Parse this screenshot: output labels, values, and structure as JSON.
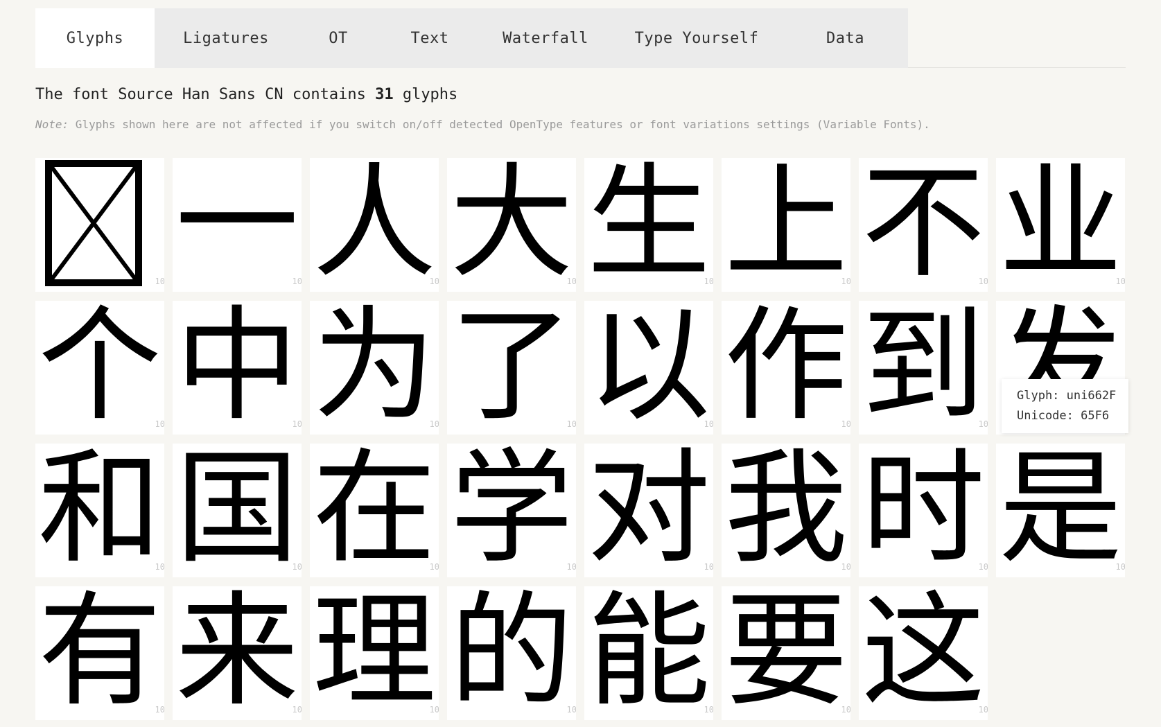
{
  "tabs": [
    {
      "label": "Glyphs",
      "active": true
    },
    {
      "label": "Ligatures",
      "active": false
    },
    {
      "label": "OT",
      "active": false
    },
    {
      "label": "Text",
      "active": false
    },
    {
      "label": "Waterfall",
      "active": false
    },
    {
      "label": "Type Yourself",
      "active": false
    },
    {
      "label": "Data",
      "active": false
    }
  ],
  "summary": {
    "prefix": "The font Source Han Sans CN contains ",
    "count": "31",
    "suffix": " glyphs"
  },
  "note": {
    "label": "Note:",
    "text": " Glyphs shown here are not affected if you switch on/off detected OpenType features or font variations settings (Variable Fonts)."
  },
  "glyphs": [
    {
      "char": "",
      "notdef": true,
      "num": "10"
    },
    {
      "char": "一",
      "num": "10"
    },
    {
      "char": "人",
      "num": "10"
    },
    {
      "char": "大",
      "num": "10"
    },
    {
      "char": "生",
      "num": "10"
    },
    {
      "char": "上",
      "num": "10"
    },
    {
      "char": "不",
      "num": "10"
    },
    {
      "char": "业",
      "num": "10"
    },
    {
      "char": "个",
      "num": "10"
    },
    {
      "char": "中",
      "num": "10"
    },
    {
      "char": "为",
      "num": "10"
    },
    {
      "char": "了",
      "num": "10"
    },
    {
      "char": "以",
      "num": "10"
    },
    {
      "char": "作",
      "num": "10"
    },
    {
      "char": "到",
      "num": "10"
    },
    {
      "char": "发",
      "num": "10"
    },
    {
      "char": "和",
      "num": "10"
    },
    {
      "char": "国",
      "num": "10"
    },
    {
      "char": "在",
      "num": "10"
    },
    {
      "char": "学",
      "num": "10"
    },
    {
      "char": "对",
      "num": "10"
    },
    {
      "char": "我",
      "num": "10"
    },
    {
      "char": "时",
      "num": "10"
    },
    {
      "char": "是",
      "num": "10"
    },
    {
      "char": "有",
      "num": "10"
    },
    {
      "char": "来",
      "num": "10"
    },
    {
      "char": "理",
      "num": "10"
    },
    {
      "char": "的",
      "num": "10"
    },
    {
      "char": "能",
      "num": "10"
    },
    {
      "char": "要",
      "num": "10"
    },
    {
      "char": "这",
      "num": "10"
    }
  ],
  "tooltip": {
    "glyph": "Glyph: uni662F",
    "unicode": "Unicode: 65F6"
  }
}
